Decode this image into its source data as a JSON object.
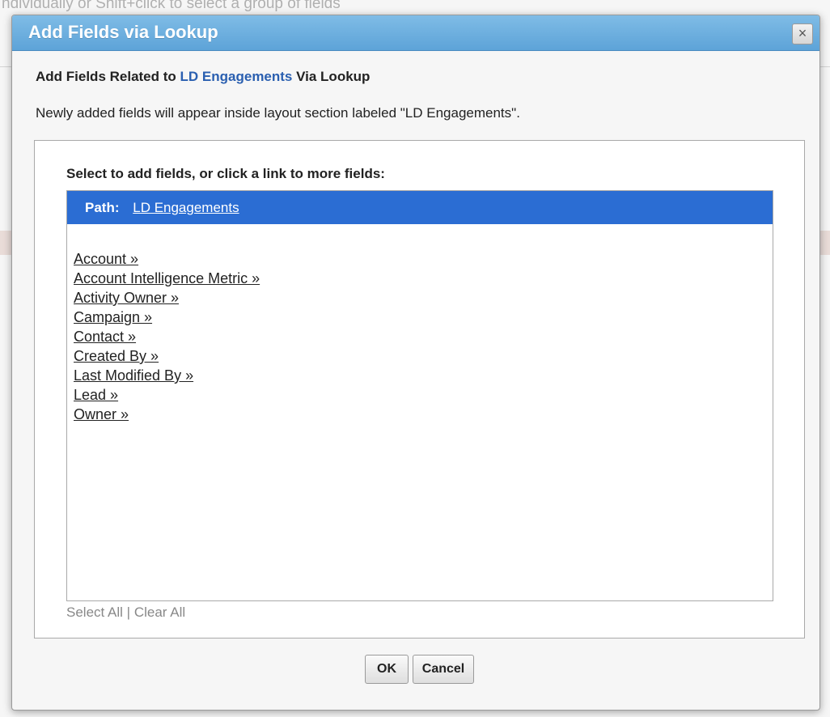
{
  "background": {
    "hint_text": "ndividually or Shift+click to select a group of fields"
  },
  "dialog": {
    "title": "Add Fields via Lookup",
    "close_symbol": "×",
    "heading": {
      "prefix": "Add Fields Related to ",
      "link": "LD Engagements",
      "suffix": " Via Lookup"
    },
    "description": "Newly added fields will appear inside layout section labeled \"LD Engagements\".",
    "prompt": "Select to add fields, or click a link to more fields:",
    "path": {
      "label": "Path:",
      "link": "LD Engagements"
    },
    "items": [
      "Account »",
      "Account Intelligence Metric »",
      "Activity Owner »",
      "Campaign »",
      "Contact »",
      "Created By »",
      "Last Modified By »",
      "Lead »",
      "Owner »"
    ],
    "select_all": "Select All",
    "separator": "|",
    "clear_all": "Clear All",
    "ok_label": "OK",
    "cancel_label": "Cancel"
  }
}
